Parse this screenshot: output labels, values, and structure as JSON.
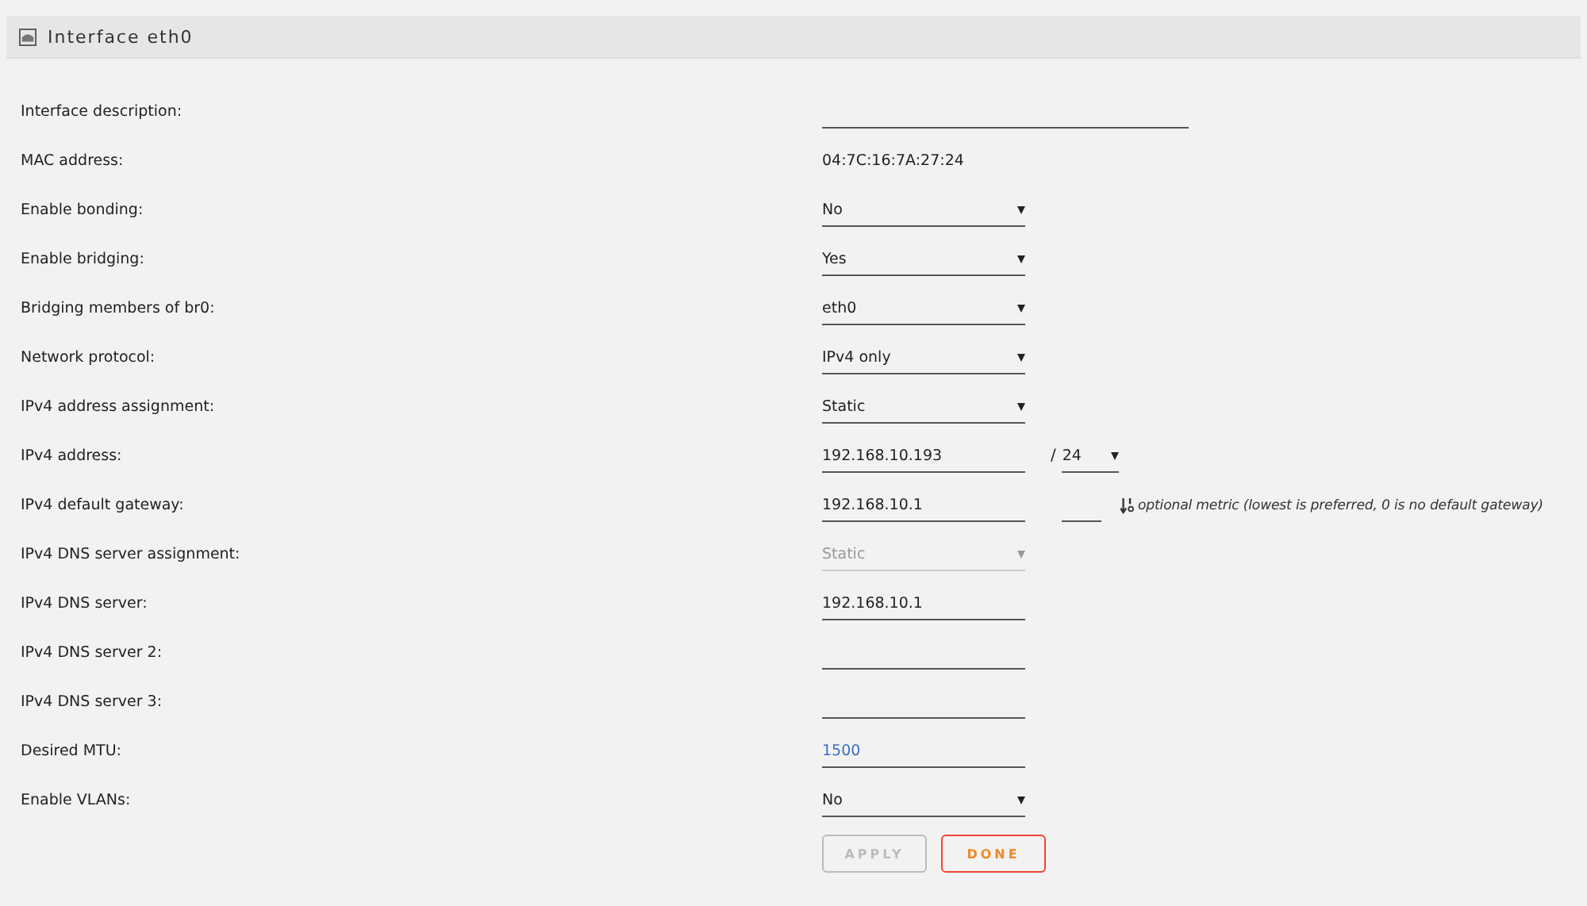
{
  "panel": {
    "title": "Interface eth0"
  },
  "rows": [
    {
      "label": "Interface description:",
      "kind": "input",
      "wide": true
    },
    {
      "label": "MAC address:",
      "kind": "text",
      "value": "04:7C:16:7A:27:24"
    },
    {
      "label": "Enable bonding:",
      "kind": "select",
      "value": "No",
      "disabled": false
    },
    {
      "label": "Enable bridging:",
      "kind": "select",
      "value": "Yes",
      "disabled": false
    },
    {
      "label": "Bridging members of br0:",
      "kind": "select",
      "value": "eth0",
      "disabled": false
    },
    {
      "label": "Network protocol:",
      "kind": "select",
      "value": "IPv4 only",
      "disabled": false
    },
    {
      "label": "IPv4 address assignment:",
      "kind": "select",
      "value": "Static",
      "disabled": false
    },
    {
      "label": "IPv4 address:",
      "kind": "input",
      "value": "192.168.10.193",
      "prefix": {
        "separator": "/",
        "value": "24"
      }
    },
    {
      "label": "IPv4 default gateway:",
      "kind": "input",
      "value": "192.168.10.1",
      "metric": {
        "note": "optional metric (lowest is preferred, 0 is no default gateway)"
      }
    },
    {
      "label": "IPv4 DNS server assignment:",
      "kind": "select",
      "value": "Static",
      "disabled": true
    },
    {
      "label": "IPv4 DNS server:",
      "kind": "input",
      "value": "192.168.10.1"
    },
    {
      "label": "IPv4 DNS server 2:",
      "kind": "input"
    },
    {
      "label": "IPv4 DNS server 3:",
      "kind": "input"
    },
    {
      "label": "Desired MTU:",
      "kind": "input",
      "placeholder": "1500"
    },
    {
      "label": "Enable VLANs:",
      "kind": "select",
      "value": "No",
      "disabled": false
    }
  ],
  "buttons": [
    {
      "label": "APPLY",
      "disabled": true
    },
    {
      "label": "DONE",
      "disabled": false
    }
  ]
}
